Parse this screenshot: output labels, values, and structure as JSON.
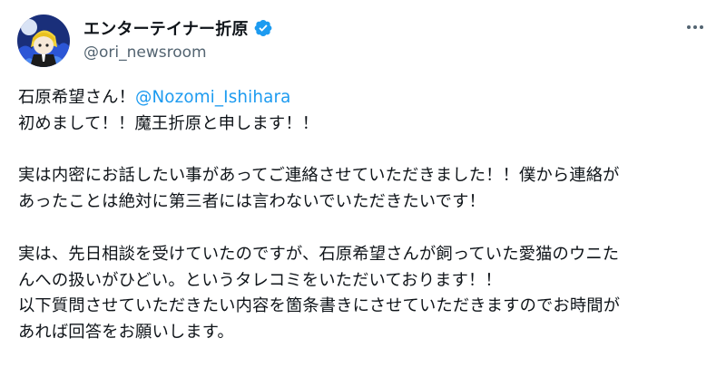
{
  "author": {
    "display_name": "エンターテイナー折原",
    "handle": "@ori_newsroom",
    "verified": true
  },
  "post": {
    "line1_prefix": "石原希望さん！",
    "line1_mention": "@Nozomi_Ishihara",
    "line2": "初めまして！！魔王折原と申します！！",
    "line4": "実は内密にお話したい事があってご連絡させていただきました！！僕から連絡が",
    "line5": "あったことは絶対に第三者には言わないでいただきたいです！",
    "line7": "実は、先日相談を受けていたのですが、石原希望さんが飼っていた愛猫のウニた",
    "line8": "んへの扱いがひどい。というタレコミをいただいております！！",
    "line9": "以下質問させていただきたい内容を箇条書きにさせていただきますのでお時間が",
    "line10": "あれば回答をお願いします。"
  },
  "icons": {
    "verified": "verified-badge-icon",
    "more": "more-options-icon"
  },
  "colors": {
    "text": "#0f1419",
    "secondary": "#536471",
    "accent": "#1d9bf0"
  }
}
